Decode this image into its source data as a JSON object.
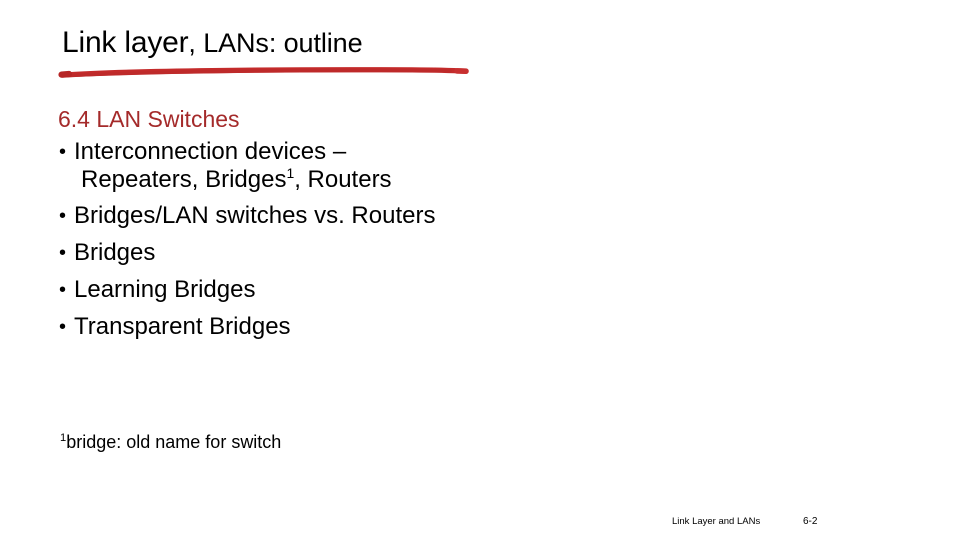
{
  "slide": {
    "background_color": "#ffffff",
    "title": {
      "main": "Link layer",
      "rest": ", LANs: outline",
      "underline_color": "#C42B2B"
    },
    "section_heading": {
      "text": "6.4 LAN Switches",
      "color": "#A42A2A"
    },
    "bullets": [
      {
        "marker": "•",
        "line1": "Interconnection devices –",
        "line2_prefix": "Repeaters, Bridges",
        "line2_sup": "1",
        "line2_suffix": ", Routers"
      },
      {
        "marker": "•",
        "line1": "Bridges/LAN switches vs. Routers"
      },
      {
        "marker": "•",
        "line1": "Bridges"
      },
      {
        "marker": "•",
        "line1": "Learning Bridges"
      },
      {
        "marker": "•",
        "line1": "Transparent Bridges"
      }
    ],
    "footnote": {
      "sup": "1",
      "text": "bridge: old name for switch"
    },
    "footer": {
      "label": "Link Layer and LANs",
      "page_number": "6-2"
    }
  }
}
